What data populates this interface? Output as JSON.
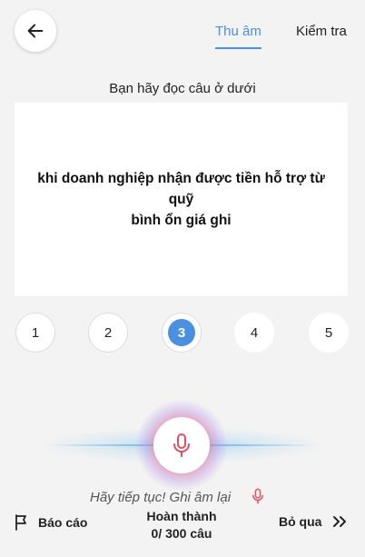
{
  "header": {
    "back_icon": "arrow-left-icon",
    "tabs": [
      {
        "label": "Thu âm",
        "active": true
      },
      {
        "label": "Kiểm tra",
        "active": false
      }
    ],
    "accent_color": "#4a8fe0"
  },
  "instruction": "Bạn hãy đọc câu ở dưới",
  "sentence": {
    "line1": "khi doanh nghiệp nhận được tiền hỗ trợ từ quỹ",
    "line2": "bình ổn giá ghi"
  },
  "steps": {
    "items": [
      "1",
      "2",
      "3",
      "4",
      "5"
    ],
    "current": "3"
  },
  "recorder": {
    "mic_icon": "microphone-icon",
    "mic_color": "#e0505f",
    "hint": "Hãy tiếp tục! Ghi âm lại"
  },
  "footer": {
    "report_label": "Báo cáo",
    "report_icon": "flag-icon",
    "progress_title": "Hoàn thành",
    "progress_count": "0/ 300 câu",
    "skip_label": "Bỏ qua",
    "skip_icon": "double-chevron-right-icon"
  }
}
